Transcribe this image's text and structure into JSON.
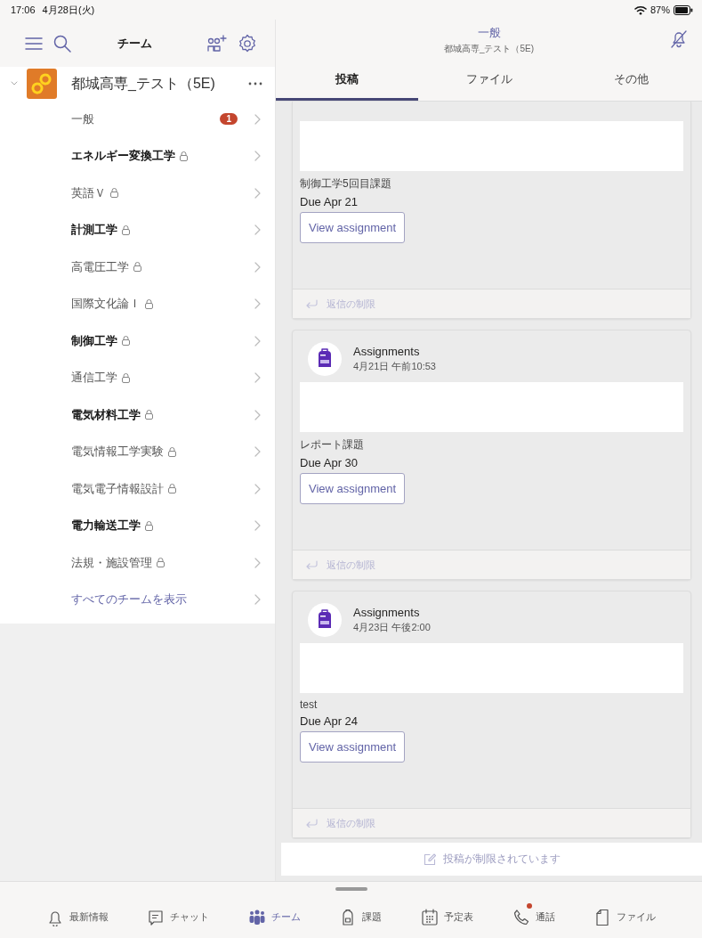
{
  "status_bar": {
    "time": "17:06",
    "date": "4月28日(火)",
    "battery": "87%"
  },
  "sidebar": {
    "title": "チーム",
    "team": {
      "name": "都城高専_テスト（5E)",
      "expanded": true
    },
    "channels": [
      {
        "kind": "channel",
        "name": "一般",
        "unread": false,
        "locked": false,
        "badge": "1"
      },
      {
        "kind": "channel",
        "name": "エネルギー変換工学",
        "unread": true,
        "locked": true
      },
      {
        "kind": "channel",
        "name": "英語Ｖ",
        "unread": false,
        "locked": true
      },
      {
        "kind": "channel",
        "name": "計測工学",
        "unread": true,
        "locked": true
      },
      {
        "kind": "channel",
        "name": "高電圧工学",
        "unread": false,
        "locked": true
      },
      {
        "kind": "channel",
        "name": "国際文化論Ｉ",
        "unread": false,
        "locked": true
      },
      {
        "kind": "channel",
        "name": "制御工学",
        "unread": true,
        "locked": true
      },
      {
        "kind": "channel",
        "name": "通信工学",
        "unread": false,
        "locked": true
      },
      {
        "kind": "channel",
        "name": "電気材料工学",
        "unread": true,
        "locked": true
      },
      {
        "kind": "channel",
        "name": "電気情報工学実験",
        "unread": false,
        "locked": true
      },
      {
        "kind": "channel",
        "name": "電気電子情報設計",
        "unread": false,
        "locked": true
      },
      {
        "kind": "channel",
        "name": "電力輸送工学",
        "unread": true,
        "locked": true
      },
      {
        "kind": "channel",
        "name": "法規・施設管理",
        "unread": false,
        "locked": true
      },
      {
        "kind": "link",
        "name": "すべてのチームを表示"
      }
    ]
  },
  "channel_header": {
    "title": "一般",
    "subtitle": "都城高専_テスト（5E)",
    "muted": true
  },
  "tabs": [
    {
      "label": "投稿",
      "selected": true
    },
    {
      "label": "ファイル",
      "selected": false
    },
    {
      "label": "その他",
      "selected": false
    }
  ],
  "posts": [
    {
      "task": "制御工学5回目課題",
      "due": "Due Apr 21",
      "button": "View assignment",
      "reply": "返信の制限"
    },
    {
      "author": "Assignments",
      "time": "4月21日 午前10:53",
      "task": "レポート課題",
      "due": "Due Apr 30",
      "button": "View assignment",
      "reply": "返信の制限"
    },
    {
      "author": "Assignments",
      "time": "4月23日 午後2:00",
      "task": "test",
      "due": "Due Apr 24",
      "button": "View assignment",
      "reply": "返信の制限"
    }
  ],
  "composer": {
    "label": "投稿が制限されています"
  },
  "bottom_nav": [
    {
      "kind": "bell",
      "label": "最新情報",
      "selected": false,
      "dot": false
    },
    {
      "kind": "chat",
      "label": "チャット",
      "selected": false,
      "dot": false
    },
    {
      "kind": "teams",
      "label": "チーム",
      "selected": true,
      "dot": false
    },
    {
      "kind": "bag",
      "label": "課題",
      "selected": false,
      "dot": false
    },
    {
      "kind": "calendar",
      "label": "予定表",
      "selected": false,
      "dot": false
    },
    {
      "kind": "phone",
      "label": "通話",
      "selected": false,
      "dot": true
    },
    {
      "kind": "file",
      "label": "ファイル",
      "selected": false,
      "dot": false
    }
  ]
}
